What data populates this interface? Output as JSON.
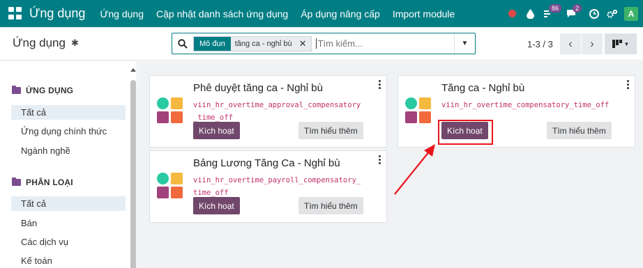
{
  "navbar": {
    "brand": "Ứng dụng",
    "menu": [
      "Ứng dụng",
      "Cập nhật danh sách ứng dụng",
      "Áp dụng nâng cấp",
      "Import module"
    ],
    "activity_count": "86",
    "message_count": "2",
    "avatar_letter": "A"
  },
  "control_panel": {
    "title": "Ứng dụng",
    "search": {
      "facet_label": "Mô đun",
      "facet_value": "tăng ca - nghỉ bù",
      "placeholder": "Tìm kiếm..."
    },
    "pager": "1-3 / 3"
  },
  "sidebar": {
    "sections": [
      {
        "header": "ỨNG DỤNG",
        "items": [
          "Tất cả",
          "Ứng dụng chính thức",
          "Ngành nghề"
        ]
      },
      {
        "header": "PHÂN LOẠI",
        "items": [
          "Tất cả",
          "Bán",
          "Các dịch vụ",
          "Kế toán"
        ]
      }
    ]
  },
  "cards": [
    {
      "title": "Phê duyệt tăng ca - Nghỉ bù",
      "module": "viin_hr_overtime_approval_compensatory_time_off",
      "activate": "Kích hoạt",
      "learn_more": "Tìm hiểu thêm"
    },
    {
      "title": "Tăng ca - Nghỉ bù",
      "module": "viin_hr_overtime_compensatory_time_off",
      "activate": "Kích hoạt",
      "learn_more": "Tìm hiểu thêm"
    },
    {
      "title": "Bảng Lương Tăng Ca - Nghỉ bù",
      "module": "viin_hr_overtime_payroll_compensatory_time_off",
      "activate": "Kích hoạt",
      "learn_more": "Tìm hiểu thêm"
    }
  ],
  "colors": {
    "navbar": "#017e84",
    "primary_button": "#71476b",
    "module_text": "#c0306a",
    "annotation": "#e8141a"
  }
}
